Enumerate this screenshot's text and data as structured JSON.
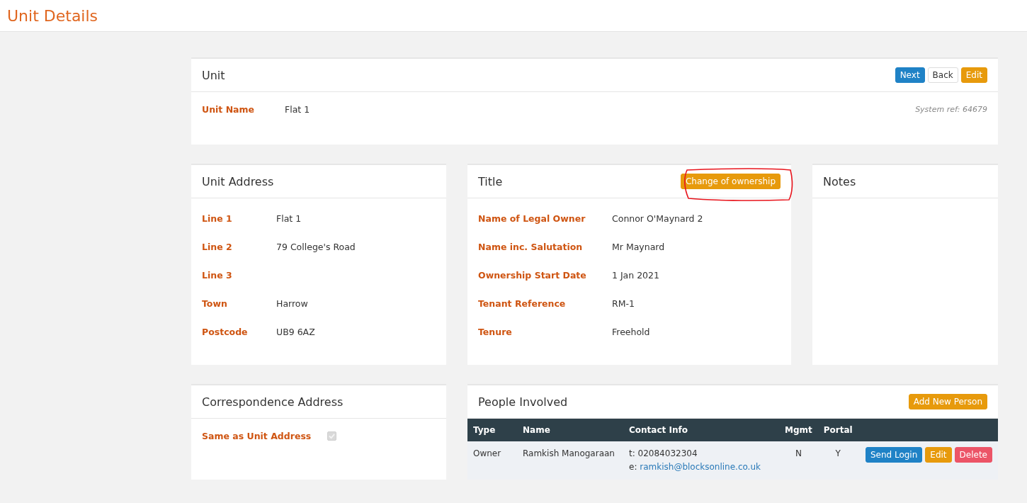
{
  "page_title": "Unit Details",
  "unit": {
    "title": "Unit",
    "buttons": [
      {
        "label": "Next",
        "kind": "primary"
      },
      {
        "label": "Back",
        "kind": "default"
      },
      {
        "label": "Edit",
        "kind": "warning"
      }
    ],
    "field": {
      "label": "Unit Name",
      "value": "Flat 1"
    },
    "system_ref": "System ref: 64679"
  },
  "unit_address": {
    "title": "Unit Address",
    "fields": [
      {
        "label": "Line 1",
        "value": "Flat 1"
      },
      {
        "label": "Line 2",
        "value": "79 College's Road"
      },
      {
        "label": "Line 3"
      },
      {
        "label": "Town",
        "value": "Harrow"
      },
      {
        "label": "Postcode",
        "value": "UB9 6AZ"
      }
    ]
  },
  "title_panel": {
    "title": "Title",
    "button": {
      "label": "Change of ownership",
      "circled": true
    },
    "fields": [
      {
        "label": "Name of Legal Owner",
        "value": "Connor O'Maynard 2"
      },
      {
        "label": "Name inc. Salutation",
        "value": "Mr Maynard"
      },
      {
        "label": "Ownership Start Date",
        "value": "1 Jan 2021"
      },
      {
        "label": "Tenant Reference",
        "value": "RM-1"
      },
      {
        "label": "Tenure",
        "value": "Freehold"
      }
    ]
  },
  "notes": {
    "title": "Notes"
  },
  "correspondence": {
    "title": "Correspondence Address",
    "field": {
      "label": "Same as Unit Address",
      "checked": true,
      "disabled": true
    }
  },
  "people": {
    "title": "People Involved",
    "add_button": "Add New Person",
    "columns": [
      "Type",
      "Name",
      "Contact Info",
      "Mgmt",
      "Portal"
    ],
    "rows": [
      {
        "type": "Owner",
        "name": "Ramkish Manogaraan",
        "phone_prefix": "t:",
        "phone": "02084032304",
        "email_prefix": "e:",
        "email": "ramkish@blocksonline.co.uk",
        "mgmt": "N",
        "portal": "Y",
        "actions": [
          {
            "label": "Send Login",
            "kind": "primary"
          },
          {
            "label": "Edit",
            "kind": "warning"
          },
          {
            "label": "Delete",
            "kind": "danger"
          }
        ]
      }
    ]
  }
}
